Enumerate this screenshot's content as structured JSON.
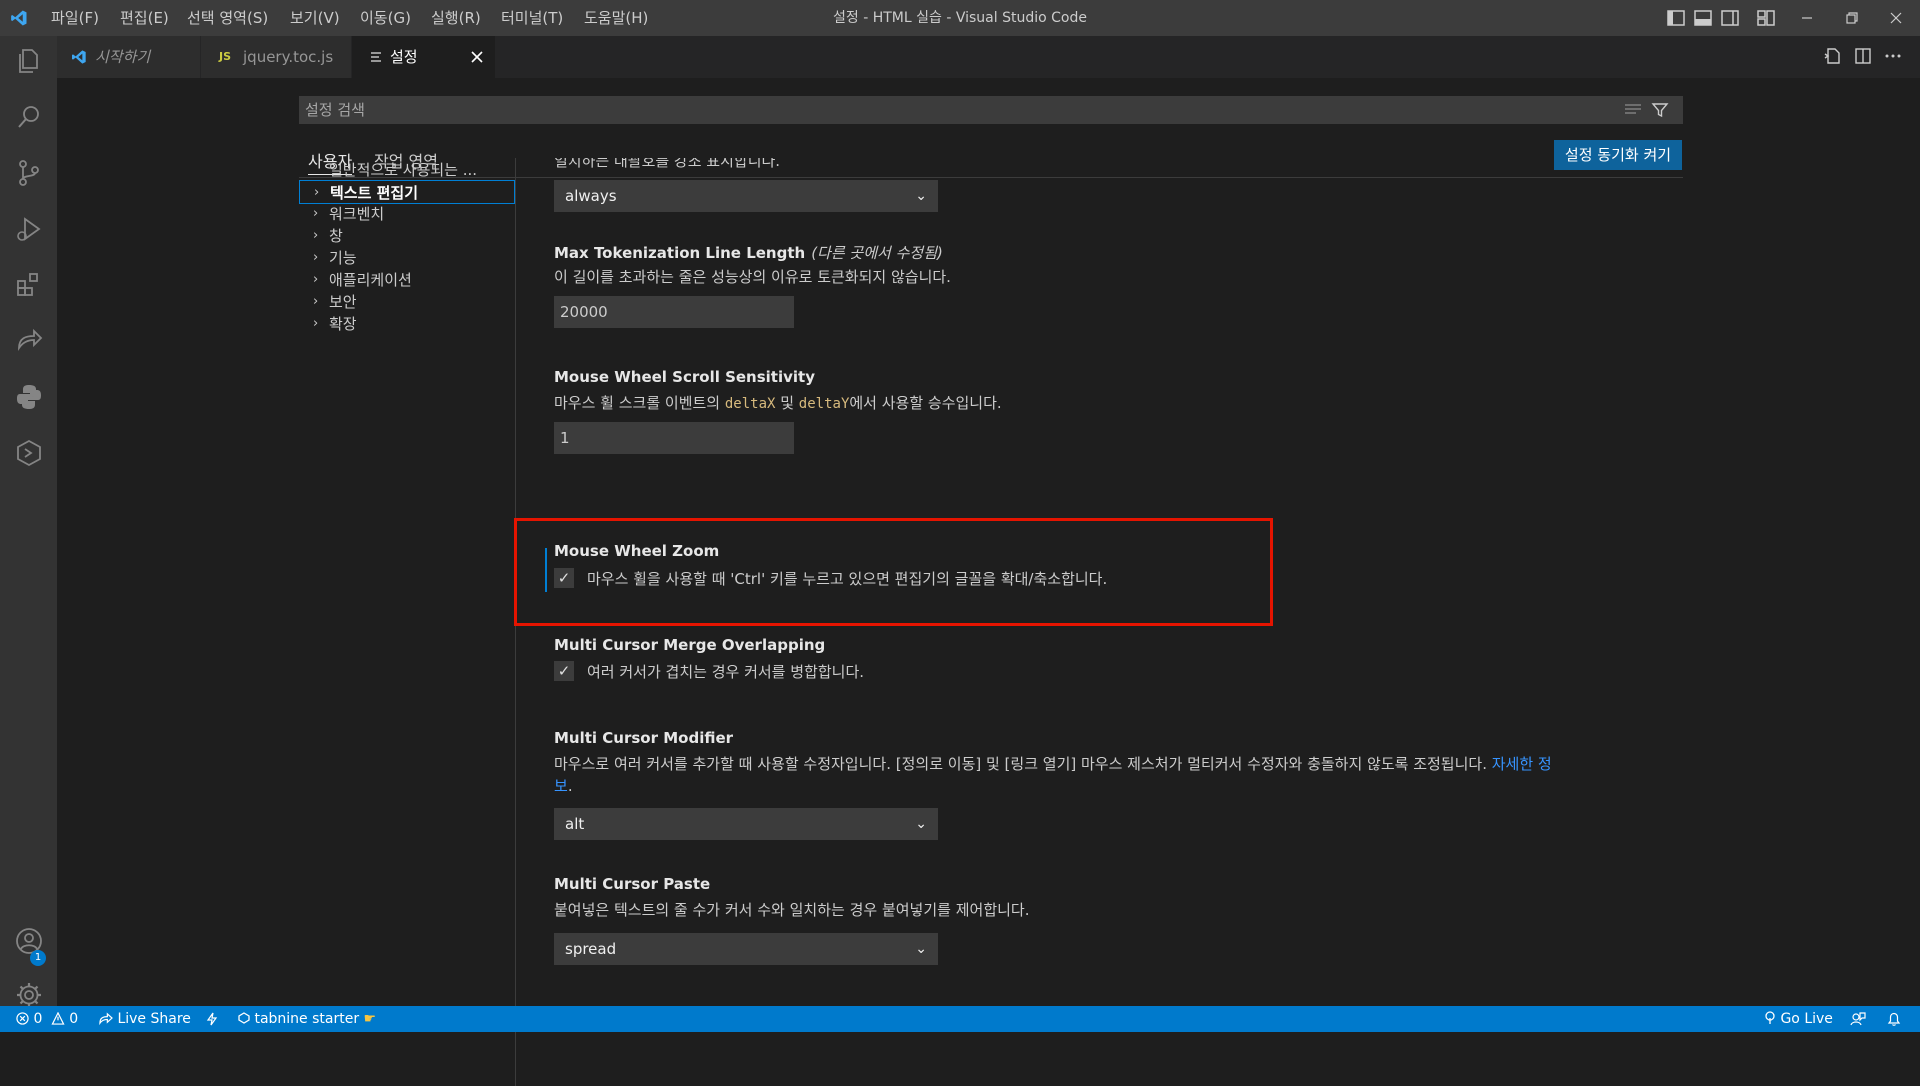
{
  "window": {
    "title": "설정 - HTML 실습 - Visual Studio Code",
    "menu": [
      "파일(F)",
      "편집(E)",
      "선택 영역(S)",
      "보기(V)",
      "이동(G)",
      "실행(R)",
      "터미널(T)",
      "도움말(H)"
    ]
  },
  "tabs": [
    {
      "label": "시작하기",
      "icon": "vscode-logo-icon"
    },
    {
      "label": "jquery.toc.js",
      "icon_text": "JS"
    },
    {
      "label": "설정",
      "icon": "settings-editor-icon",
      "active": true
    }
  ],
  "search": {
    "placeholder": "설정 검색"
  },
  "scopes": {
    "user": "사용자",
    "workspace": "작업 영역"
  },
  "sync_button": "설정 동기화 켜기",
  "toc": [
    {
      "label": "일반적으로 사용되는 ...",
      "chevron": ""
    },
    {
      "label": "텍스트 편집기",
      "chevron": "›",
      "selected": true
    },
    {
      "label": "워크벤치",
      "chevron": "›"
    },
    {
      "label": "창",
      "chevron": "›"
    },
    {
      "label": "기능",
      "chevron": "›"
    },
    {
      "label": "애플리케이션",
      "chevron": "›"
    },
    {
      "label": "보안",
      "chevron": "›"
    },
    {
      "label": "확장",
      "chevron": "›"
    }
  ],
  "settings": {
    "match_brackets": {
      "desc": "일치하는 대괄호를 강조 표시합니다.",
      "value": "always"
    },
    "max_tokenization": {
      "title": "Max Tokenization Line Length",
      "modified": "(다른 곳에서 수정됨)",
      "desc": "이 길이를 초과하는 줄은 성능상의 이유로 토큰화되지 않습니다.",
      "value": "20000"
    },
    "mouse_wheel_scroll": {
      "title": "Mouse Wheel Scroll Sensitivity",
      "desc_prefix": "마우스 휠 스크롤 이벤트의 ",
      "code1": "deltaX",
      "desc_mid": " 및 ",
      "code2": "deltaY",
      "desc_suffix": "에서 사용할 승수입니다.",
      "value": "1"
    },
    "mouse_wheel_zoom": {
      "title": "Mouse Wheel Zoom",
      "desc": "마우스 휠을 사용할 때 'Ctrl' 키를 누르고 있으면 편집기의 글꼴을 확대/축소합니다.",
      "checked": true
    },
    "multi_cursor_merge": {
      "title": "Multi Cursor Merge Overlapping",
      "desc": "여러 커서가 겹치는 경우 커서를 병합합니다.",
      "checked": true
    },
    "multi_cursor_modifier": {
      "title": "Multi Cursor Modifier",
      "desc_line1": "마우스로 여러 커서를 추가할 때 사용할 수정자입니다. [정의로 이동] 및 [링크 열기] 마우스 제스처가 멀티커서 수정자와 충돌하지 않도록 조정됩니다. ",
      "link1": "자세한 정",
      "link2": "보",
      "desc_line2_suffix": ".",
      "value": "alt"
    },
    "multi_cursor_paste": {
      "title": "Multi Cursor Paste",
      "desc": "붙여넣은 텍스트의 줄 수가 커서 수와 일치하는 경우 붙여넣기를 제어합니다.",
      "value": "spread"
    }
  },
  "checkmark": "✓",
  "caret": "⌄",
  "statusbar": {
    "errors": "0",
    "warnings": "0",
    "live_share": "Live Share",
    "tabnine": "tabnine starter",
    "go_live": "Go Live"
  },
  "accounts_badge": "1",
  "colors": {
    "accent": "#007acc",
    "highlight": "#e51400",
    "button": "#0e639c"
  }
}
